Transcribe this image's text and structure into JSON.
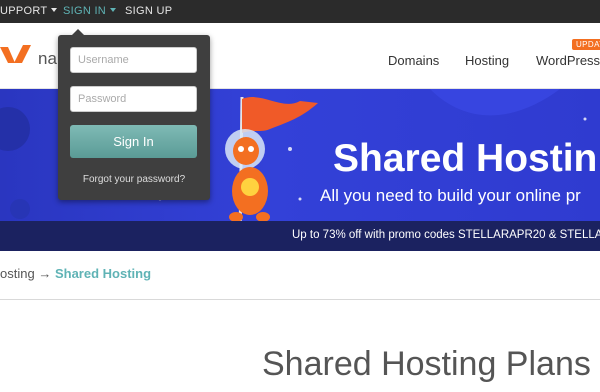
{
  "topbar": {
    "support_label": "UPPORT",
    "signin_label": "SIGN IN",
    "signup_label": "SIGN UP"
  },
  "header": {
    "logo_text": "na",
    "nav": [
      "Domains",
      "Hosting",
      "WordPress"
    ],
    "badge": "UPDAT"
  },
  "signin_dropdown": {
    "username_placeholder": "Username",
    "password_placeholder": "Password",
    "submit_label": "Sign In",
    "forgot_label": "Forgot your password?"
  },
  "hero": {
    "title": "Shared Hostin",
    "subtitle": "All you need to build your online pr",
    "promo": "Up to 73% off with promo codes STELLARAPR20 & STELLA"
  },
  "breadcrumb": {
    "parent": "osting",
    "separator": "→",
    "current": "Shared Hosting"
  },
  "main": {
    "title": "Shared Hosting Plans"
  },
  "colors": {
    "topbar_bg": "#2b2b2b",
    "accent_teal": "#5fb3b5",
    "brand_orange": "#f36f21",
    "hero_blue": "#3341d8",
    "promo_bar": "#1b2260"
  },
  "icons": [
    "caret-down-icon",
    "brand-logo-icon"
  ]
}
